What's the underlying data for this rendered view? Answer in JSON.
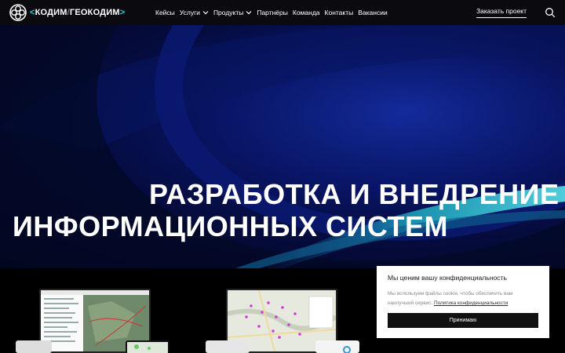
{
  "header": {
    "logo": {
      "left_bracket": "<",
      "brand_1": "КОДИМ",
      "separator": "/",
      "brand_2": "ГЕОКОДИМ",
      "right_bracket": ">"
    },
    "nav": [
      {
        "label": "Кейсы",
        "has_dropdown": false
      },
      {
        "label": "Услуги",
        "has_dropdown": true
      },
      {
        "label": "Продукты",
        "has_dropdown": true
      },
      {
        "label": "Партнёры",
        "has_dropdown": false
      },
      {
        "label": "Команда",
        "has_dropdown": false
      },
      {
        "label": "Контакты",
        "has_dropdown": false
      },
      {
        "label": "Вакансии",
        "has_dropdown": false
      }
    ],
    "order_label": "Заказать проект",
    "search_icon": "search-icon"
  },
  "hero": {
    "title_line1": "РАЗРАБОТКА И ВНЕДРЕНИЕ",
    "title_line2": "ИНФОРМАЦИОННЫХ СИСТЕМ"
  },
  "cookie": {
    "title": "Мы ценим вашу конфиденциальность",
    "text": "Мы используем файлы cookie, чтобы обеспечить вам наилучший сервис.",
    "link": "Политика конфиденциальности",
    "accept_label": "Принимаю"
  },
  "colors": {
    "accent": "#36c6d3",
    "hero_dark": "#02051a",
    "hero_blue": "#0c1f7a",
    "header_bg": "#0b0b0f"
  }
}
